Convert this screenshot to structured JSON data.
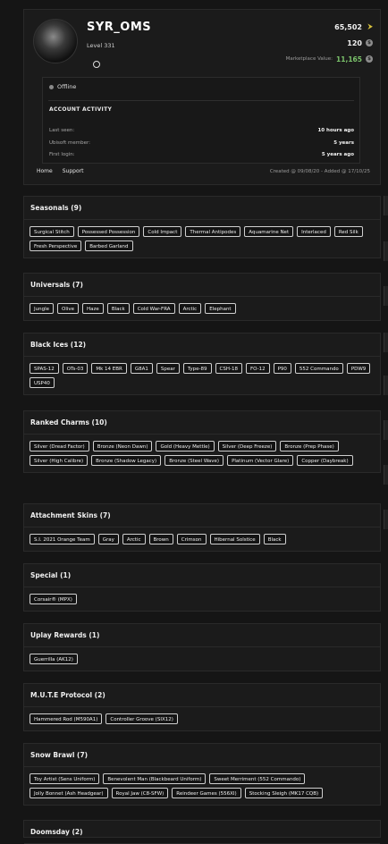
{
  "profile": {
    "username": "SYR_OMS",
    "level": "Level 331",
    "renown": "65,502",
    "credits": "120",
    "marketplace_label": "Marketplace Value:",
    "marketplace_value": "11,165",
    "coin_glyph": "$",
    "arrow_glyph": "⮞",
    "platform_icon": "ubisoft-icon"
  },
  "activity": {
    "status": "Offline",
    "title": "ACCOUNT ACTIVITY",
    "rows": [
      {
        "label": "Last seen:",
        "value": "10 hours ago"
      },
      {
        "label": "Ubisoft member:",
        "value": "5 years"
      },
      {
        "label": "First login:",
        "value": "5 years ago"
      }
    ]
  },
  "nav": {
    "home": "Home",
    "support": "Support"
  },
  "created": "Created @ 09/08/20 - Added @ 17/10/25",
  "sections": [
    {
      "title": "Seasonals (9)",
      "items": [
        "Surgical Stitch",
        "Possessed Possession",
        "Cold Impact",
        "Thermal Antipodes",
        "Aquamarine Net",
        "Interlaced",
        "Red Silk",
        "Fresh Perspective",
        "Barbed Garland"
      ]
    },
    {
      "title": "Universals (7)",
      "items": [
        "Jungle",
        "Olive",
        "Haze",
        "Black",
        "Cold War-FRA",
        "Arctic",
        "Elephant"
      ]
    },
    {
      "title": "Black Ices (12)",
      "items": [
        "SPAS-12",
        "OTs-03",
        "Mk 14 EBR",
        "G8A1",
        "Spear",
        "Type-89",
        "CSH-18",
        "FO-12",
        "P90",
        "552 Commando",
        "PDW9",
        "USP40"
      ]
    },
    {
      "title": "Ranked Charms (10)",
      "items": [
        "Silver (Dread Factor)",
        "Bronze (Neon Dawn)",
        "Gold (Heavy Mettle)",
        "Silver (Deep Freeze)",
        "Bronze (Prep Phase)",
        "Silver (High Calibre)",
        "Bronze (Shadow Legacy)",
        "Bronze (Steel Wave)",
        "Platinum (Vector Glare)",
        "Copper (Daybreak)"
      ]
    },
    {
      "title": "Attachment Skins (7)",
      "items": [
        "S.I. 2021 Orange Team",
        "Gray",
        "Arctic",
        "Brown",
        "Crimson",
        "Hibernal Solstice",
        "Black"
      ]
    },
    {
      "title": "Special (1)",
      "items": [
        "Corsair® (MPX)"
      ]
    },
    {
      "title": "Uplay Rewards (1)",
      "items": [
        "Guerrilla (AK12)"
      ]
    },
    {
      "title": "M.U.T.E Protocol (2)",
      "items": [
        "Hammered Rod (M590A1)",
        "Controller Groove (SIX12)"
      ]
    },
    {
      "title": "Snow Brawl (7)",
      "items": [
        "Toy Artist (Sens Uniform)",
        "Benevolent Man (Blackbeard Uniform)",
        "Sweet Merriment (552 Commando)",
        "Jolly Bonnet (Ash Headgear)",
        "Royal Jaw (C8-SFW)",
        "Reindeer Games (556XI)",
        "Stocking Sleigh (MK17 CQB)"
      ]
    },
    {
      "title": "Doomsday (2)",
      "items": []
    }
  ]
}
